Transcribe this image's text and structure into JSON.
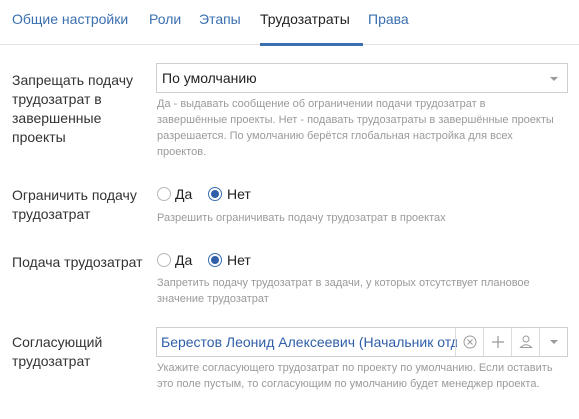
{
  "tabs": [
    {
      "label": "Общие настройки",
      "active": false
    },
    {
      "label": "Роли",
      "active": false
    },
    {
      "label": "Этапы",
      "active": false
    },
    {
      "label": "Трудозатраты",
      "active": true
    },
    {
      "label": "Права",
      "active": false
    }
  ],
  "completed_projects": {
    "label": "Запрещать подачу трудозатрат в завершенные проекты",
    "value": "По умолчанию",
    "hint": "Да - выдавать сообщение об ограничении подачи трудозатрат в завершённые проекты. Нет - подавать трудозатраты в завершённые проекты разрешается. По умолчанию берётся глобальная настройка для всех проектов."
  },
  "limit_submission": {
    "label": "Ограничить подачу трудозатрат",
    "options": [
      "Да",
      "Нет"
    ],
    "selected": "Нет",
    "hint": "Разрешить ограничивать подачу трудозатрат в проектах"
  },
  "submission": {
    "label": "Подача трудозатрат",
    "options": [
      "Да",
      "Нет"
    ],
    "selected": "Нет",
    "hint": "Запретить подачу трудозатрат в задачи, у которых отсутствует плановое значение трудозатрат"
  },
  "approver": {
    "label": "Согласующий трудозатрат",
    "value": "Берестов Леонид Алексеевич (Начальник отдела)",
    "hint": "Укажите согласующего трудозатрат по проекту по умолчанию. Если оставить это поле пустым, то согласующим по умолчанию будет менеджер проекта."
  },
  "colors": {
    "accent": "#3a6fb0",
    "link": "#2f5fa8",
    "hint": "#9a9a9a"
  },
  "icons": [
    "clear-icon",
    "plus-icon",
    "person-icon",
    "chevron-down-icon"
  ]
}
